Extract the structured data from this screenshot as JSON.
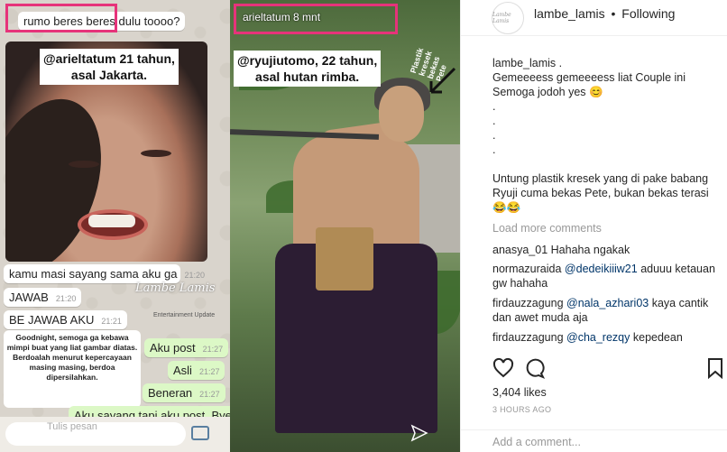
{
  "post": {
    "chat_panel": {
      "top_bubble": "rumo beres beres dulu toooo?",
      "caption_top": "@arieltatum 21 tahun,\nasal Jakarta.",
      "bubbles": [
        {
          "text": "kamu masi sayang sama aku ga",
          "time": "21:20",
          "dir": "in"
        },
        {
          "text": "JAWAB",
          "time": "21:20",
          "dir": "in"
        },
        {
          "text": "BE JAWAB AKU",
          "time": "21:21",
          "dir": "in"
        },
        {
          "text": "Aku post",
          "time": "21:27",
          "dir": "out"
        },
        {
          "text": "Asli",
          "time": "21:27",
          "dir": "out"
        },
        {
          "text": "Beneran",
          "time": "21:27",
          "dir": "out"
        },
        {
          "text": "Aku sayang tapi aku post. Bye.",
          "time": "",
          "dir": "out"
        }
      ],
      "goodnight": "Goodnight, semoga ga kebawa mimpi buat yang liat gambar diatas. Berdoalah menurut kepercayaan masing masing, berdoa dipersilahkan.",
      "watermark": "Lambe Lamis",
      "watermark_sub": "Entertainment Update",
      "input_placeholder": "Tulis pesan"
    },
    "photo_panel": {
      "top_label": "arieltatum  8 mnt",
      "caption": "@ryujiutomo, 22 tahun,\nasal hutan rimba.",
      "side_note": "Plastik kresek bekas Pete"
    }
  },
  "header": {
    "username": "lambe_lamis",
    "separator": "•",
    "follow_label": "Following",
    "avatar_text": "Lambe Lamis"
  },
  "caption": {
    "username": "lambe_lamis",
    "lines": [
      "lambe_lamis .",
      "Gemeeeess gemeeeess liat Couple ini",
      "Semoga jodoh yes 😊",
      ".",
      ".",
      ".",
      ".",
      "",
      "Untung plastik kresek yang di pake babang Ryuji cuma bekas Pete, bukan bekas terasi 😂😂"
    ]
  },
  "load_more": "Load more comments",
  "comments": [
    {
      "user": "anasya_01",
      "mention": "",
      "text": "Hahaha ngakak"
    },
    {
      "user": "normazuraida",
      "mention": "@dedeikiiiw21",
      "text": "aduuu ketauan gw hahaha"
    },
    {
      "user": "firdauzzagung",
      "mention": "@nala_azhari03",
      "text": "kaya cantik dan awet muda aja"
    },
    {
      "user": "firdauzzagung",
      "mention": "@cha_rezqy",
      "text": "kepedean"
    }
  ],
  "likes": "3,404 likes",
  "time_ago": "3 HOURS AGO",
  "add_comment_placeholder": "Add a comment...",
  "icons": [
    "heart-icon",
    "comment-icon",
    "bookmark-icon",
    "send-icon",
    "camera-icon"
  ],
  "colors": {
    "highlight": "#e6337a",
    "mention": "#003569",
    "muted": "#999999"
  }
}
